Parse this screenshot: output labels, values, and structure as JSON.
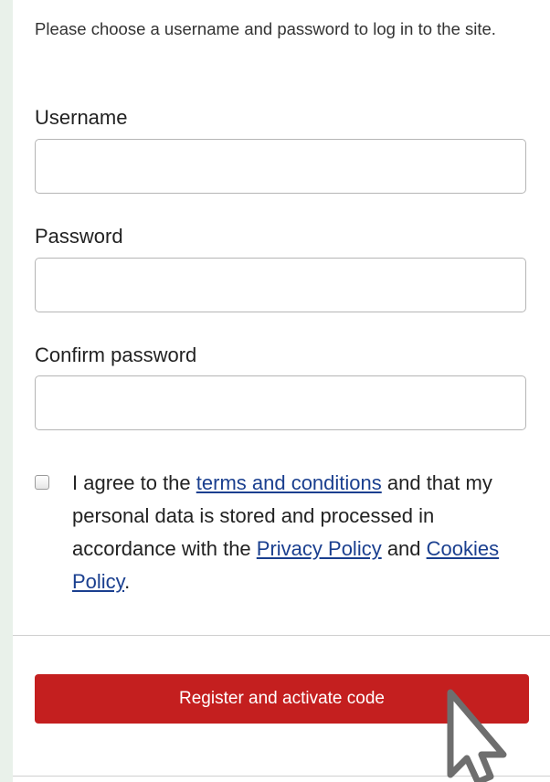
{
  "form": {
    "intro_text": "Please choose a username and password to log in to the site.",
    "username_label": "Username",
    "username_value": "",
    "password_label": "Password",
    "password_value": "",
    "confirm_label": "Confirm password",
    "confirm_value": "",
    "consent": {
      "checked": false,
      "text_before": "I agree to the ",
      "terms_link": "terms and conditions",
      "text_middle": " and that my personal data is stored and processed in accordance with the ",
      "privacy_link": "Privacy Policy",
      "text_and": " and ",
      "cookies_link": "Cookies Policy",
      "text_end": "."
    },
    "submit_label": "Register and activate code"
  },
  "colors": {
    "page_background": "#e9f1ea",
    "submit_button": "#c41f1f",
    "link": "#1a3f8f"
  },
  "cursor_icon": "mouse-pointer-icon"
}
